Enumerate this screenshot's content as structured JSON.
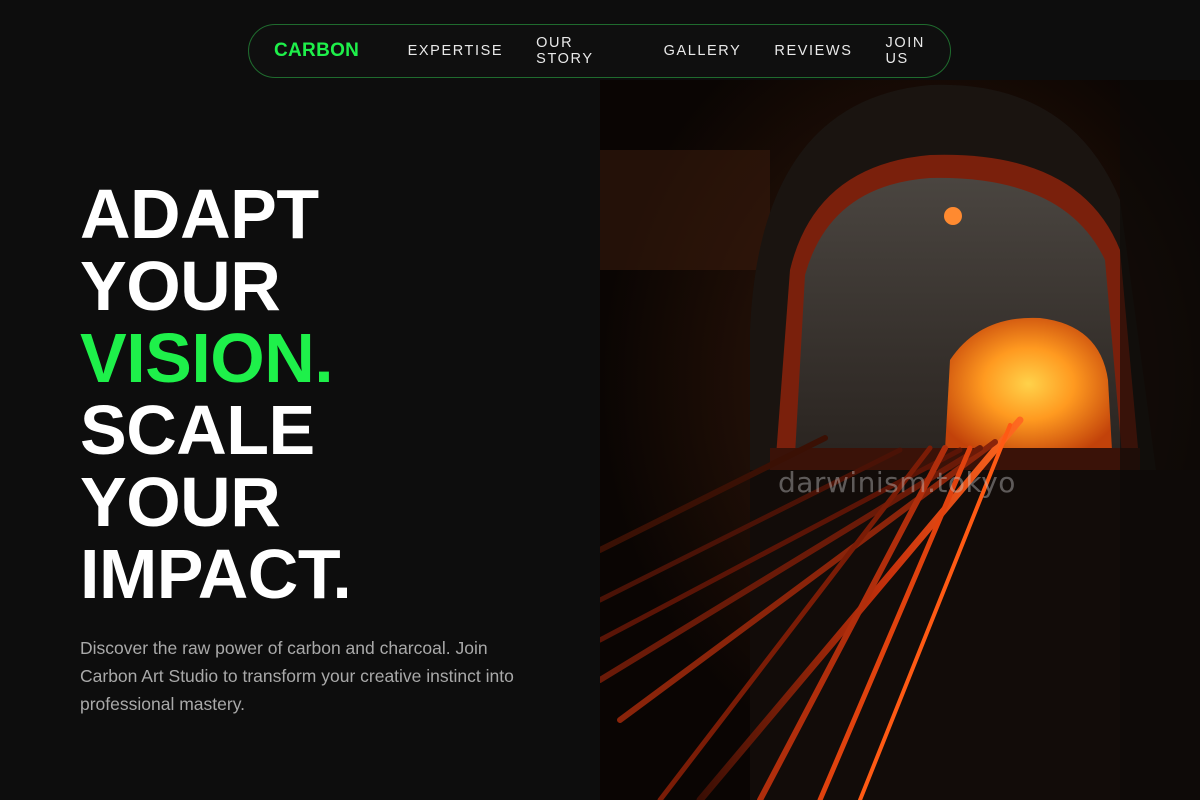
{
  "nav": {
    "brand": "CARBON",
    "links": [
      {
        "label": "EXPERTISE"
      },
      {
        "label": "OUR STORY"
      },
      {
        "label": "GALLERY"
      },
      {
        "label": "REVIEWS"
      },
      {
        "label": "JOIN US"
      }
    ]
  },
  "hero": {
    "headline_lines": [
      "ADAPT",
      "YOUR",
      "VISION.",
      "SCALE",
      "YOUR",
      "IMPACT."
    ],
    "accent_line": "VISION.",
    "description": "Discover the raw power of carbon and charcoal. Join Carbon Art Studio to transform your creative instinct into professional mastery.",
    "image_watermark": "darwinism.tokyo"
  },
  "colors": {
    "background": "#0d0d0d",
    "accent": "#1ef04a",
    "nav_border": "#1f6b2e",
    "text_primary": "#ffffff",
    "text_muted": "#a9a9a9"
  }
}
